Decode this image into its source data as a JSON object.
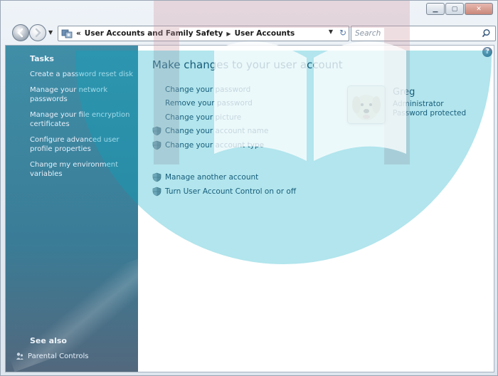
{
  "window": {
    "caption_buttons": [
      "minimize",
      "maximize",
      "close"
    ]
  },
  "navigation": {
    "breadcrumb_prefix": "«",
    "breadcrumb": [
      "User Accounts and Family Safety",
      "User Accounts"
    ],
    "search_placeholder": "Search"
  },
  "sidebar": {
    "tasks_heading": "Tasks",
    "tasks": [
      "Create a password reset disk",
      "Manage your network passwords",
      "Manage your file encryption certificates",
      "Configure advanced user profile properties",
      "Change my environment variables"
    ],
    "see_also_heading": "See also",
    "see_also": [
      "Parental Controls"
    ]
  },
  "main": {
    "title": "Make changes to your user account",
    "actions": [
      {
        "label": "Change your password",
        "shield": false
      },
      {
        "label": "Remove your password",
        "shield": false
      },
      {
        "label": "Change your picture",
        "shield": false
      },
      {
        "label": "Change your account name",
        "shield": true
      },
      {
        "label": "Change your account type",
        "shield": true
      }
    ],
    "other_actions": [
      {
        "label": "Manage another account",
        "shield": true
      },
      {
        "label": "Turn User Account Control on or off",
        "shield": true
      }
    ]
  },
  "user": {
    "name": "Greg",
    "role": "Administrator",
    "status": "Password protected"
  },
  "colors": {
    "sidebar_bg": "#4b6e8c",
    "link_text": "#1e3a5a",
    "watermark_cyan": "#00aac3"
  }
}
